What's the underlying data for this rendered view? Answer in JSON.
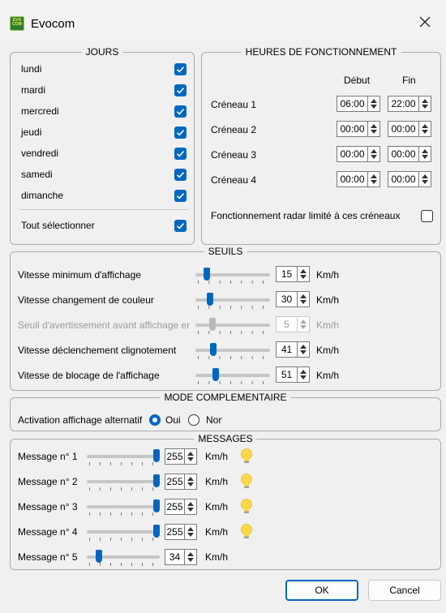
{
  "window": {
    "title": "Evocom",
    "icon": "app-icon",
    "icon_text": "EVO COM"
  },
  "jours": {
    "title": "JOURS",
    "days": [
      "lundi",
      "mardi",
      "mercredi",
      "jeudi",
      "vendredi",
      "samedi",
      "dimanche"
    ],
    "checked": [
      true,
      true,
      true,
      true,
      true,
      true,
      true
    ],
    "select_all_label": "Tout sélectionner",
    "select_all_checked": true
  },
  "heures": {
    "title": "HEURES DE FONCTIONNEMENT",
    "col_start": "Début",
    "col_end": "Fin",
    "slots": [
      {
        "label": "Créneau 1",
        "start": "06:00",
        "end": "22:00"
      },
      {
        "label": "Créneau 2",
        "start": "00:00",
        "end": "00:00"
      },
      {
        "label": "Créneau 3",
        "start": "00:00",
        "end": "00:00"
      },
      {
        "label": "Créneau 4",
        "start": "00:00",
        "end": "00:00"
      }
    ],
    "limit_label": "Fonctionnement radar limité à ces créneaux",
    "limit_checked": false
  },
  "seuils": {
    "title": "SEUILS",
    "unit": "Km/h",
    "rows": [
      {
        "label": "Vitesse minimum d'affichage",
        "value": "15",
        "level": 0.12,
        "enabled": true
      },
      {
        "label": "Vitesse changement de couleur",
        "value": "30",
        "level": 0.17,
        "enabled": true
      },
      {
        "label": "Seuil d'avertissement avant affichage en",
        "value": "5",
        "level": 0.2,
        "enabled": false
      },
      {
        "label": "Vitesse déclenchement clignotement",
        "value": "41",
        "level": 0.22,
        "enabled": true
      },
      {
        "label": "Vitesse de blocage de l'affichage",
        "value": "51",
        "level": 0.25,
        "enabled": true
      }
    ]
  },
  "mode": {
    "title": "MODE COMPLEMENTAIRE",
    "label": "Activation affichage alternatif",
    "yes": "Oui",
    "no": "Non",
    "selected": "Oui"
  },
  "messages": {
    "title": "MESSAGES",
    "unit": "Km/h",
    "rows": [
      {
        "label": "Message n° 1",
        "value": "255",
        "level": 1.0,
        "bulb": true
      },
      {
        "label": "Message n° 2",
        "value": "255",
        "level": 1.0,
        "bulb": true
      },
      {
        "label": "Message n° 3",
        "value": "255",
        "level": 1.0,
        "bulb": true
      },
      {
        "label": "Message n° 4",
        "value": "255",
        "level": 1.0,
        "bulb": true
      },
      {
        "label": "Message n° 5",
        "value": "34",
        "level": 0.13,
        "bulb": false
      }
    ]
  },
  "buttons": {
    "ok": "OK",
    "cancel": "Cancel"
  },
  "colors": {
    "accent": "#0067c0",
    "bulb": "#fbd74a"
  }
}
